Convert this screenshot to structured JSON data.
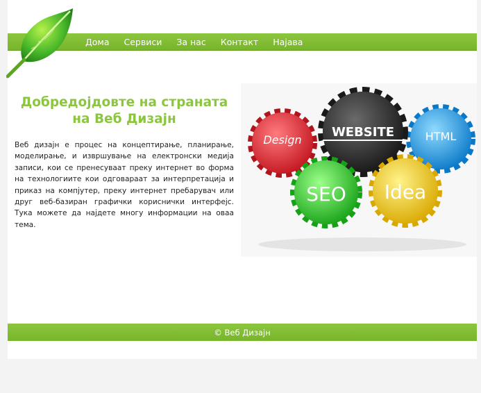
{
  "nav": {
    "items": [
      {
        "label": "Дома"
      },
      {
        "label": "Сервиси"
      },
      {
        "label": "За нас"
      },
      {
        "label": "Контакт"
      },
      {
        "label": "Најава"
      }
    ]
  },
  "main": {
    "title": "Добредојдовте на страната на Веб Дизајн",
    "description": "Веб дизајн е процес на концептирање, планирање, моделирање, и извршување на електронски медија записи, кои се пренесуваат преку интернет во форма на технологиите кои одговараат за интерпретација и приказ на компјутер, преку интернет пребарувач или друг веб-базиран графички кориснички интерфејс. Тука можете да најдете многу информации на оваа тема."
  },
  "gears": {
    "website": "WEBSITE",
    "design": "Design",
    "html": "HTML",
    "seo": "SEO",
    "idea": "Idea"
  },
  "footer": {
    "text": "© Веб Дизајн"
  },
  "colors": {
    "accent": "#8cc63f",
    "page_bg": "#f3f3f4",
    "gear_red": "#e8323c",
    "gear_dark": "#333333",
    "gear_blue": "#1fa3e8",
    "gear_green": "#3cc832",
    "gear_yellow": "#f2d21e"
  }
}
